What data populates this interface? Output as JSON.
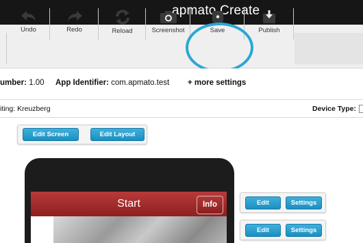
{
  "app": {
    "title": "apmato Create"
  },
  "toolbar": {
    "undo_label": "Undo",
    "redo_label": "Redo",
    "reload_label": "Reload",
    "screenshot_label": "Screenshot",
    "save_label": "Save",
    "publish_label": "Publish"
  },
  "info": {
    "number_label": "umber:",
    "number_value": "1.00",
    "app_identifier_label": "App Identifier:",
    "app_identifier_value": "com.apmato.test",
    "more_settings": "+ more settings"
  },
  "editing": {
    "label": "iting:",
    "value": "Kreuzberg",
    "device_type_label": "Device Type:"
  },
  "screen_buttons": {
    "edit_screen": "Edit Screen",
    "edit_layout": "Edit Layout"
  },
  "phone": {
    "title": "Start",
    "info_button": "Info"
  },
  "side_rows": [
    {
      "edit": "Edit",
      "settings": "Settings"
    },
    {
      "edit": "Edit",
      "settings": "Settings"
    }
  ],
  "colors": {
    "accent": "#2aa7d3",
    "button_blue": "#1a8fc0",
    "header_red": "#a52c2c",
    "titlebar": "#161616"
  }
}
